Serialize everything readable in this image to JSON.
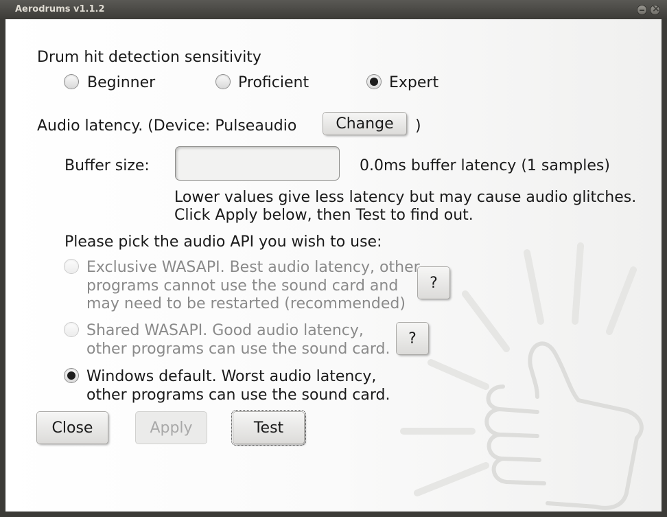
{
  "window": {
    "title": "Aerodrums v1.1.2"
  },
  "sensitivity": {
    "heading": "Drum hit detection sensitivity",
    "options": [
      {
        "label": "Beginner",
        "checked": false
      },
      {
        "label": "Proficient",
        "checked": false
      },
      {
        "label": "Expert",
        "checked": true
      }
    ]
  },
  "latency": {
    "label": "Audio latency.  (Device: Pulseaudio",
    "change_label": "Change",
    "close_paren": ")",
    "buffer_label": "Buffer size:",
    "buffer_value": "",
    "buffer_info": "0.0ms buffer latency (1 samples)",
    "hint_line1": "Lower values give less latency but may cause audio glitches.",
    "hint_line2": "Click Apply below, then Test to find out."
  },
  "api": {
    "heading": "Please pick the audio API you wish to use:",
    "options": [
      {
        "lines": [
          "Exclusive WASAPI. Best audio latency, other",
          "programs cannot use the sound card and",
          "may need to be restarted (recommended)"
        ],
        "checked": false,
        "enabled": false,
        "help": "?"
      },
      {
        "lines": [
          "Shared WASAPI. Good audio latency,",
          "other programs can use the sound card."
        ],
        "checked": false,
        "enabled": false,
        "help": "?"
      },
      {
        "lines": [
          "Windows default. Worst audio latency,",
          "other programs can use the sound card."
        ],
        "checked": true,
        "enabled": true
      }
    ]
  },
  "footer": {
    "close_label": "Close",
    "apply_label": "Apply",
    "test_label": "Test"
  }
}
